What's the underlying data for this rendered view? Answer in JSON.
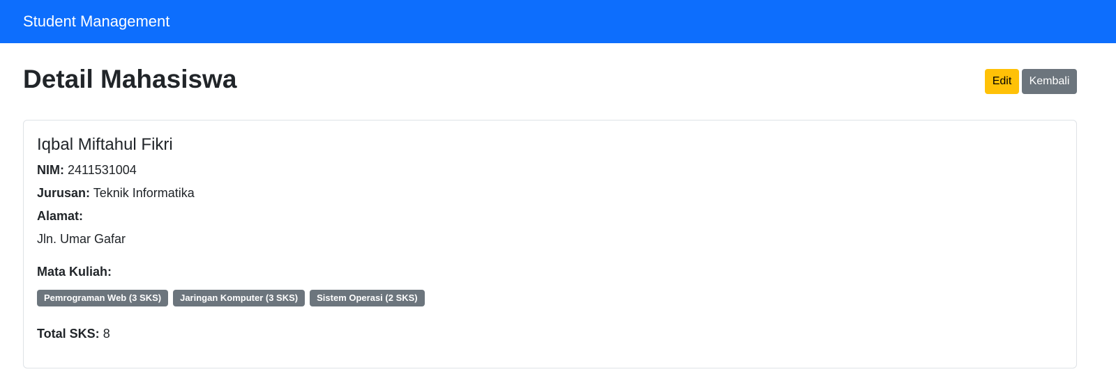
{
  "navbar": {
    "brand": "Student Management",
    "color": "#0d6efd"
  },
  "page": {
    "title": "Detail Mahasiswa"
  },
  "actions": {
    "edit_label": "Edit",
    "back_label": "Kembali"
  },
  "student": {
    "name": "Iqbal Miftahul Fikri",
    "nim_label": "NIM:",
    "nim": "2411531004",
    "jurusan_label": "Jurusan:",
    "jurusan": "Teknik Informatika",
    "alamat_label": "Alamat:",
    "alamat": "Jln. Umar Gafar",
    "mata_kuliah_label": "Mata Kuliah:",
    "mata_kuliah": [
      "Pemrograman Web (3 SKS)",
      "Jaringan Komputer (3 SKS)",
      "Sistem Operasi (2 SKS)"
    ],
    "total_sks_label": "Total SKS:",
    "total_sks": "8"
  },
  "colors": {
    "edit_button": "#ffc107",
    "back_button": "#6c757d",
    "badge": "#6c757d"
  }
}
